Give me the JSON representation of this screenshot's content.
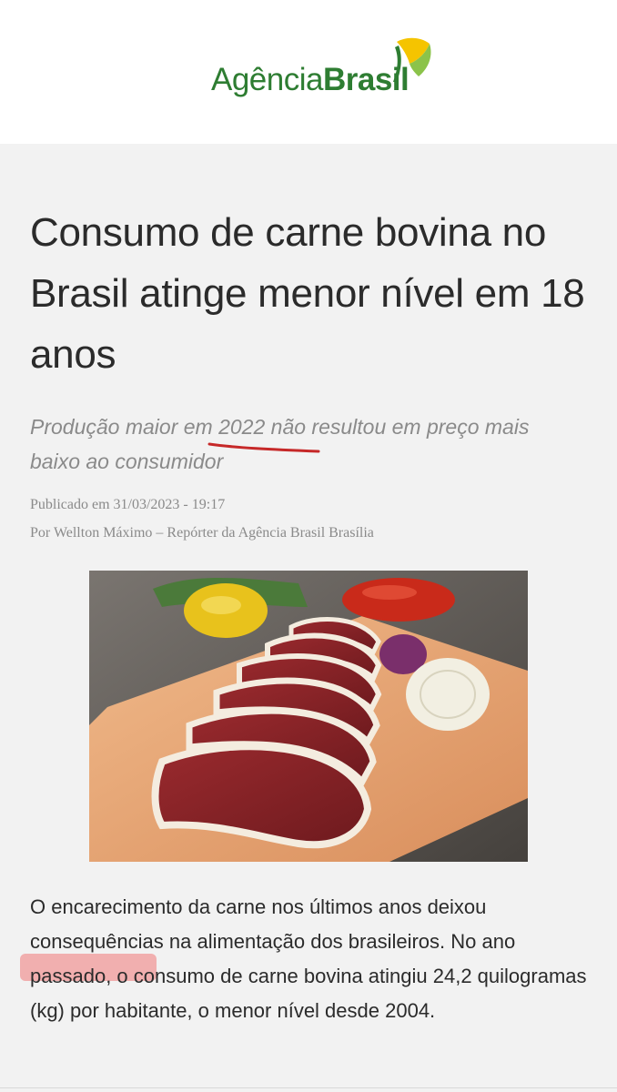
{
  "brand": {
    "name_light": "Agência",
    "name_bold": "Brasil",
    "colors": {
      "green": "#2e7d32",
      "yellow": "#f5c400",
      "light_green": "#8bc34a"
    }
  },
  "article": {
    "title": "Consumo de carne bovina no Brasil atinge menor nível em 18 anos",
    "subtitle_before": "Produção maior ",
    "subtitle_marked": "em 2022",
    "subtitle_after": " não resultou em preço mais baixo ao consumidor",
    "published": "Publicado em 31/03/2023 - 19:17",
    "byline": "Por Wellton Máximo – Repórter da Agência Brasil Brasília",
    "image_alt": "Cortes de carne bovina crua sobre tábua de sal rosa com pimentões e cebola",
    "body_before": "O encarecimento da carne nos últimos anos deixou consequências na alimentação dos brasileiros. No ",
    "body_marked": "ano passado",
    "body_after": ", o consumo de carne bovina atingiu 24,2 quilogramas (kg) por habitante, o menor nível desde 2004."
  },
  "annotations": {
    "underline_color": "#c62828",
    "highlight_color": "#f07878"
  }
}
